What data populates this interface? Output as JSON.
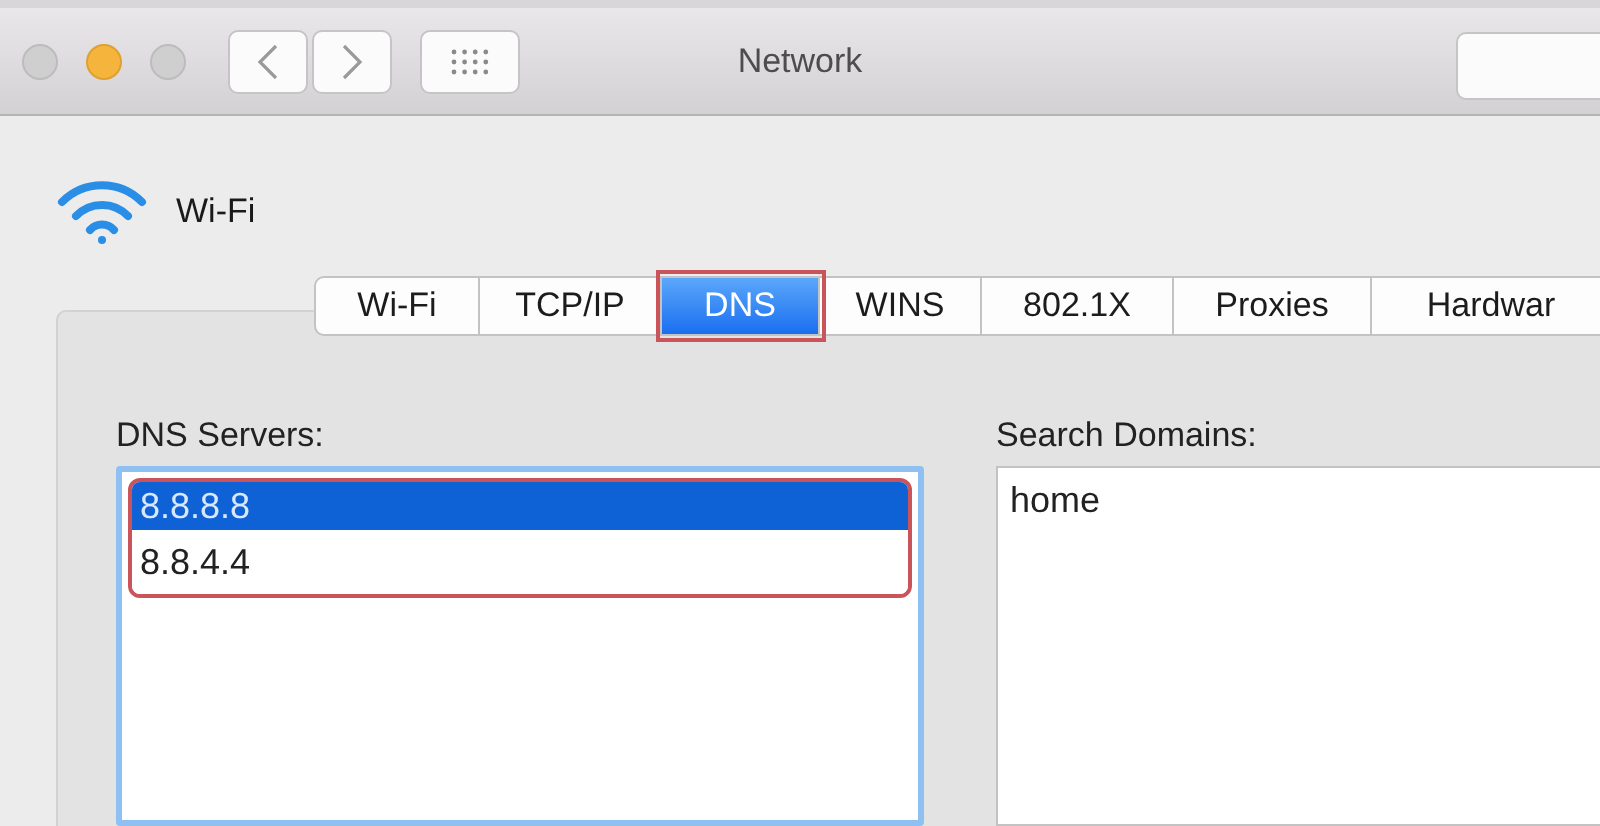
{
  "window": {
    "title": "Network"
  },
  "service": {
    "name": "Wi-Fi"
  },
  "tabs": [
    {
      "label": "Wi-Fi",
      "selected": false,
      "highlighted": false
    },
    {
      "label": "TCP/IP",
      "selected": false,
      "highlighted": false
    },
    {
      "label": "DNS",
      "selected": true,
      "highlighted": true
    },
    {
      "label": "WINS",
      "selected": false,
      "highlighted": false
    },
    {
      "label": "802.1X",
      "selected": false,
      "highlighted": false
    },
    {
      "label": "Proxies",
      "selected": false,
      "highlighted": false
    },
    {
      "label": "Hardwar",
      "selected": false,
      "highlighted": false
    }
  ],
  "dns_servers": {
    "label": "DNS Servers:",
    "highlighted": true,
    "items": [
      {
        "address": "8.8.8.8",
        "selected": true
      },
      {
        "address": "8.8.4.4",
        "selected": false
      }
    ]
  },
  "search_domains": {
    "label": "Search Domains:",
    "items": [
      {
        "domain": "home",
        "selected": false
      }
    ]
  }
}
